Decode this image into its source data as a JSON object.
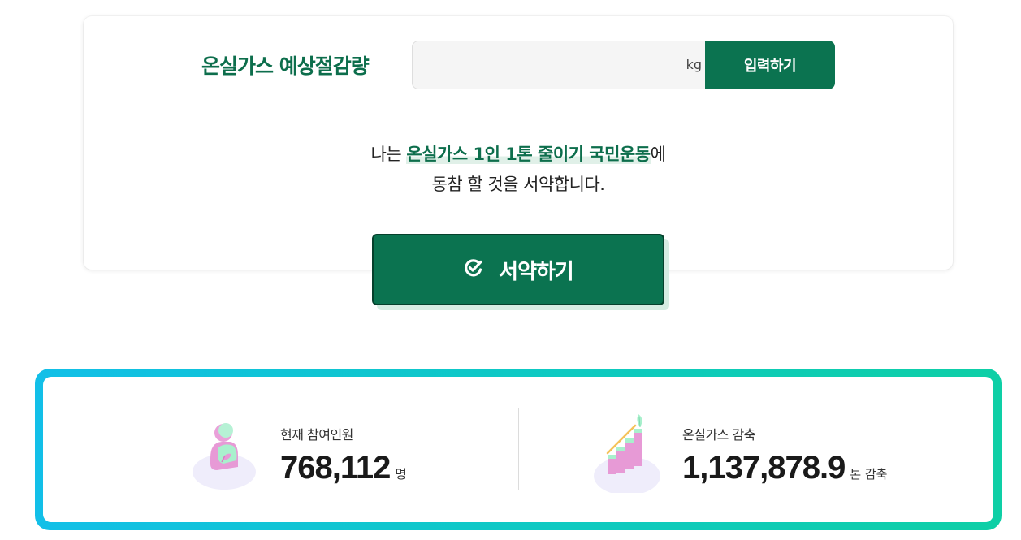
{
  "pledge": {
    "input_label": "온실가스 예상절감량",
    "input_value": "",
    "unit": "kg",
    "submit_label": "입력하기",
    "text_prefix": "나는 ",
    "text_highlight": "온실가스 1인 1톤 줄이기 국민운동",
    "text_suffix": "에",
    "text_line2": "동참 할 것을 서약합니다.",
    "sign_label": "서약하기"
  },
  "stats": {
    "participants": {
      "label": "현재 참여인원",
      "value": "768,112",
      "unit": "명",
      "icon": "person-leaf-icon"
    },
    "reduction": {
      "label": "온실가스 감축",
      "value": "1,137,878.9",
      "unit": "톤 감축",
      "icon": "growth-chart-icon"
    }
  },
  "colors": {
    "brand_green": "#0b7350",
    "frame_start": "#12bfe8",
    "frame_end": "#0ecfa6"
  }
}
